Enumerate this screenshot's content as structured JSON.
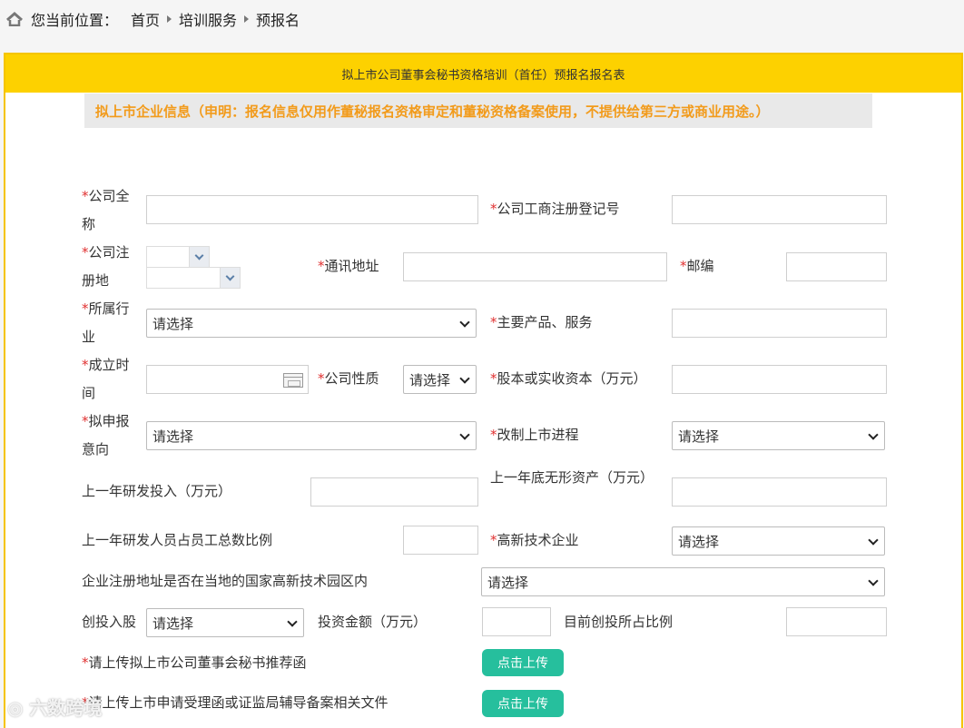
{
  "breadcrumb": {
    "prefix": "您当前位置：",
    "items": [
      "首页",
      "培训服务",
      "预报名"
    ]
  },
  "panel": {
    "title": "拟上市公司董事会秘书资格培训（首任）预报名报名表",
    "notice": "拟上市企业信息（申明：报名信息仅用作董秘报名资格审定和董秘资格备案使用，不提供给第三方或商业用途。）"
  },
  "required_mark": "*",
  "fields": {
    "company_name": "公司全称",
    "reg_number": "公司工商注册登记号",
    "reg_place": "公司注册地",
    "address": "通讯地址",
    "postcode": "邮编",
    "industry": "所属行业",
    "industry_value": "请选择",
    "main_products": "主要产品、服务",
    "founded": "成立时间",
    "company_type": "公司性质",
    "company_type_value": "请选择",
    "capital": "股本或实收资本（万元）",
    "intended": "拟申报意向",
    "intended_value": "请选择",
    "listing_progress": "改制上市进程",
    "listing_progress_value": "请选择",
    "rd_invest": "上一年研发投入（万元）",
    "intangible": "上一年底无形资产（万元）",
    "rd_staff": "上一年研发人员占员工总数比例",
    "hitech": "高新技术企业",
    "hitech_value": "请选择",
    "park": "企业注册地址是否在当地的国家高新技术园区内",
    "park_value": "请选择",
    "vc": "创投入股",
    "vc_value": "请选择",
    "invest_amount": "投资金额（万元）",
    "vc_ratio": "目前创投所占比例",
    "upload1": "请上传拟上市公司董事会秘书推荐函",
    "upload2": "请上传上市申请受理函或证监局辅导备案相关文件",
    "upload_btn": "点击上传"
  },
  "watermark": "六数跨境",
  "colors": {
    "header": "#fdd100",
    "notice_text": "#f29b1b",
    "required": "#e03030",
    "upload": "#26bf9d"
  }
}
